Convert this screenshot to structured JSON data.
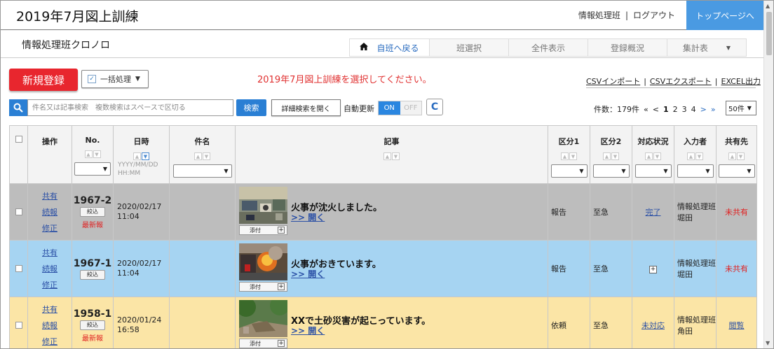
{
  "header": {
    "title": "2019年7月図上訓練",
    "group_name": "情報処理班",
    "separator": "|",
    "logout": "ログアウト",
    "top_page": "トップページへ"
  },
  "subheader": {
    "section_title": "情報処理班クロノロ",
    "tabs": [
      {
        "label": "自班へ戻る",
        "icon": "home-icon"
      },
      {
        "label": "班選択"
      },
      {
        "label": "全件表示"
      },
      {
        "label": "登録概況"
      },
      {
        "label": "集計表",
        "dropdown": "▼"
      }
    ]
  },
  "toolbar": {
    "new_button": "新規登録",
    "bulk_button": "一括処理",
    "bulk_arrow": "▼",
    "notice": "2019年7月図上訓練を選択してください。",
    "csv_import": "CSVインポート",
    "csv_export": "CSVエクスポート",
    "excel_export": "EXCEL出力",
    "link_sep": "|",
    "search_placeholder": "件名又は記事検索　複数検索はスペースで区切る",
    "search_button": "検索",
    "advanced_search": "詳細検索を開く",
    "auto_update_label": "自動更新",
    "toggle_on": "ON",
    "toggle_off": "OFF",
    "refresh_glyph": "C",
    "count_text": "件数：179件",
    "first_glyph": "«",
    "prev_glyph": "<",
    "pages": [
      "1",
      "2",
      "3",
      "4"
    ],
    "current_page": "1",
    "next_glyph": ">",
    "last_glyph": "»",
    "per_page": "50件",
    "per_page_arrow": "▼"
  },
  "table": {
    "headers": {
      "ops": "操作",
      "no": "No.",
      "datetime": "日時",
      "subject": "件名",
      "article": "記事",
      "cat1": "区分1",
      "cat2": "区分2",
      "status": "対応状況",
      "author": "入力者",
      "share": "共有先"
    },
    "date_format_line1": "YYYY/MM/DD",
    "date_format_line2": "HH:MM",
    "select_arrow": "▼",
    "rows": [
      {
        "theme": "gray",
        "ops": [
          "共有",
          "続報",
          "修正"
        ],
        "no": "1967-2",
        "narrow": "絞込",
        "latest": "最新報",
        "date": "2020/02/17",
        "time": "11:04",
        "subject": "",
        "article_title": "火事が沈火しました。",
        "article_open": ">> 開く",
        "attach": "添付",
        "thumb": "office-photo",
        "cat1": "報告",
        "cat2": "至急",
        "status": "完了",
        "author_line1": "情報処理班",
        "author_line2": "堀田",
        "share": "未共有"
      },
      {
        "theme": "blue",
        "ops": [
          "共有",
          "続報",
          "修正"
        ],
        "no": "1967-1",
        "narrow": "絞込",
        "latest": "",
        "date": "2020/02/17",
        "time": "11:04",
        "subject": "",
        "article_title": "火事がおきています。",
        "article_open": ">> 開く",
        "attach": "添付",
        "thumb": "fire-photo",
        "cat1": "報告",
        "cat2": "至急",
        "status": "",
        "author_line1": "情報処理班",
        "author_line2": "堀田",
        "share": "未共有"
      },
      {
        "theme": "yellow",
        "ops": [
          "共有",
          "続報",
          "修正"
        ],
        "no": "1958-1",
        "narrow": "絞込",
        "latest": "最新報",
        "date": "2020/01/24",
        "time": "16:58",
        "subject": "",
        "article_title": "XXで土砂災害が起こっています。",
        "article_open": ">> 開く",
        "attach": "添付",
        "thumb": "landslide-photo",
        "cat1": "依頼",
        "cat2": "至急",
        "status": "未対応",
        "author_line1": "情報処理班",
        "author_line2": "角田",
        "share": "閲覧"
      }
    ]
  },
  "colors": {
    "accent_blue": "#2a7fd4",
    "new_red": "#e8262e",
    "top_button": "#4a9ae2",
    "row_gray": "#bdbdbd",
    "row_blue": "#a6d4f2",
    "row_yellow": "#fbe5a6"
  }
}
